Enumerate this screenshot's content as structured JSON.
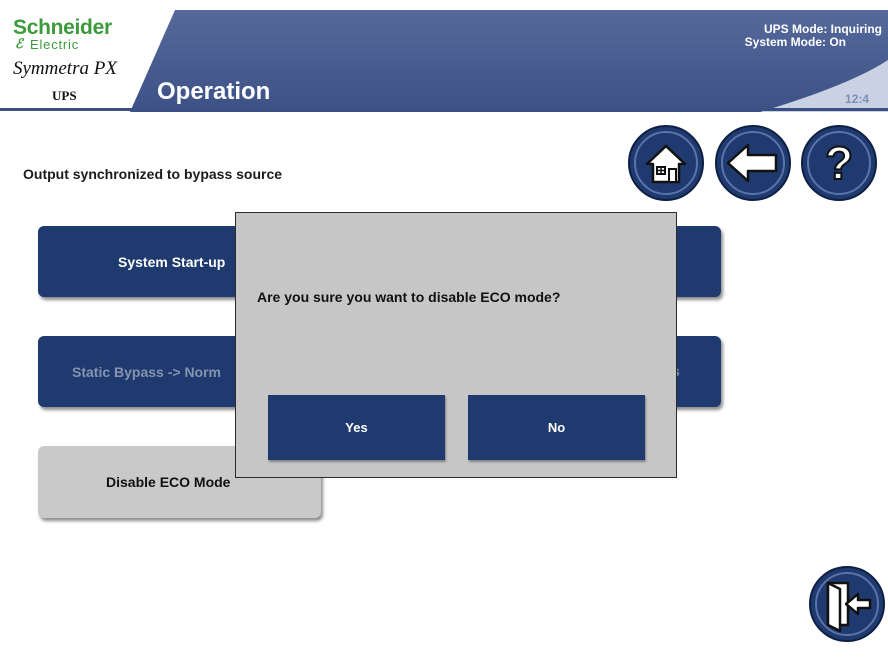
{
  "header": {
    "brand": "Schneider",
    "brand_sub": "Electric",
    "product": "Symmetra PX",
    "model": "UPS",
    "title": "Operation",
    "ups_mode": "UPS Mode: Inquiring",
    "system_mode": "System Mode: On",
    "clock": "12:4"
  },
  "main": {
    "status_message": "Output synchronized to bypass source",
    "buttons": [
      {
        "label": "System Start-up"
      },
      {
        "label": "Static Bypass -> Norm",
        "tail": "s"
      },
      {
        "label": "Disable ECO Mode"
      }
    ]
  },
  "dialog": {
    "message": "Are you sure you want to disable ECO mode?",
    "yes_label": "Yes",
    "no_label": "No"
  },
  "icons": {
    "home": "home-icon",
    "back": "arrow-left-icon",
    "help": "question-mark-icon",
    "exit": "exit-door-icon"
  },
  "colors": {
    "header_blue": "#4f6395",
    "button_blue": "#1e3a6e",
    "brand_green": "#3b9b3a",
    "dialog_gray": "#c6c6c6"
  }
}
